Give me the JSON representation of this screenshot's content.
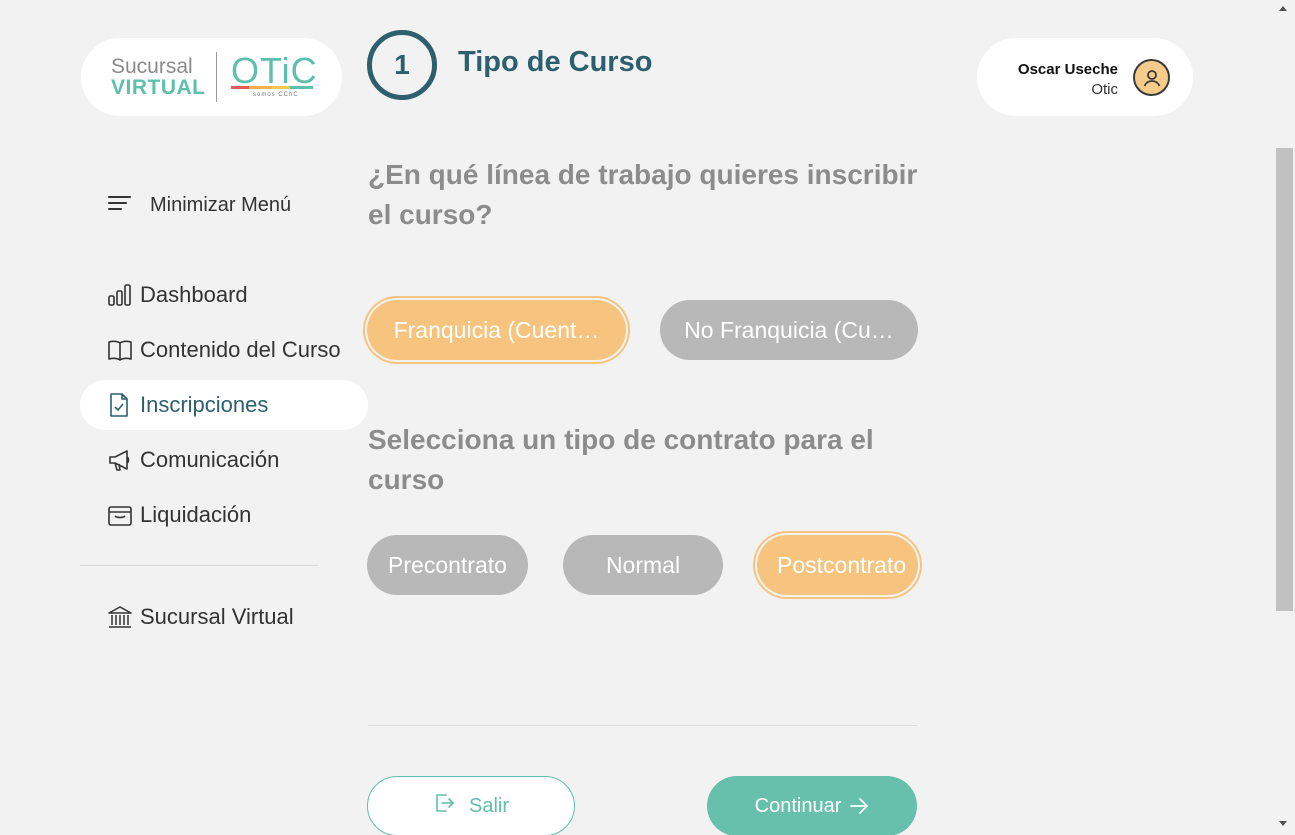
{
  "logo": {
    "line1": "Sucursal",
    "line2": "VIRTUAL",
    "brand": "OTiC",
    "tagline": "somos CChC"
  },
  "step": {
    "number": "1",
    "title": "Tipo de Curso"
  },
  "user": {
    "name": "Oscar Useche",
    "org": "Otic",
    "icon": "user-circle-icon"
  },
  "sidebar": {
    "toggle_label": "Minimizar Menú",
    "items": [
      {
        "label": "Dashboard",
        "icon": "bar-chart-icon"
      },
      {
        "label": "Contenido del Curso",
        "icon": "book-icon"
      },
      {
        "label": "Inscripciones",
        "icon": "document-check-icon",
        "active": true
      },
      {
        "label": "Comunicación",
        "icon": "megaphone-icon"
      },
      {
        "label": "Liquidación",
        "icon": "wallet-icon"
      }
    ],
    "footer_item": {
      "label": "Sucursal Virtual",
      "icon": "bank-icon"
    }
  },
  "question1": {
    "text": "¿En qué línea de trabajo quieres inscribir el curso?",
    "options": [
      "Franquicia (Cuent…",
      "No Franquicia (Cu…"
    ],
    "selected": "Franquicia (Cuent…"
  },
  "question2": {
    "text": "Selecciona un tipo de contrato para el curso",
    "options": [
      "Precontrato",
      "Normal",
      "Postcontrato"
    ],
    "selected": "Postcontrato"
  },
  "actions": {
    "exit_label": "Salir",
    "continue_label": "Continuar"
  },
  "colors": {
    "primary": "#2d5f6e",
    "accent": "#66c0ac",
    "selected": "#f6c47f",
    "unselected": "#b8b8b8"
  }
}
